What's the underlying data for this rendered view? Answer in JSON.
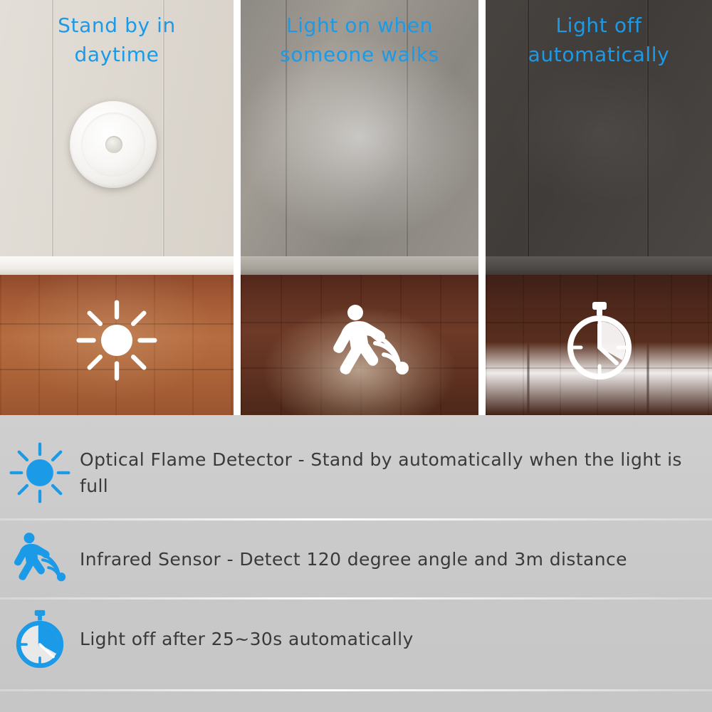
{
  "theme": {
    "accent_blue": "#1b9ae8",
    "feature_bg": "#c9c9c9",
    "feature_text": "#3a3a3a",
    "icon_white": "#ffffff"
  },
  "photo_panels": [
    {
      "id": "daytime",
      "headline": "Stand by in\ndaytime",
      "floor_icon": "sun-icon",
      "lamp_state": "off",
      "scene": "bright daytime wall"
    },
    {
      "id": "motion",
      "headline": "Light on when\nsomeone walks",
      "floor_icon": "walking-motion-sensor-icon",
      "lamp_state": "on",
      "scene": "dim wall with lamp glowing"
    },
    {
      "id": "auto-off",
      "headline": "Light off\nautomatically",
      "floor_icon": "stopwatch-icon",
      "lamp_state": "off",
      "scene": "dark wall"
    }
  ],
  "features": [
    {
      "icon": "sun-icon",
      "text": "Optical Flame Detector - Stand by automatically when the light is full"
    },
    {
      "icon": "walking-motion-sensor-icon",
      "text": "Infrared Sensor - Detect 120 degree angle and 3m distance"
    },
    {
      "icon": "stopwatch-icon",
      "text": "Light off after 25~30s automatically"
    }
  ]
}
